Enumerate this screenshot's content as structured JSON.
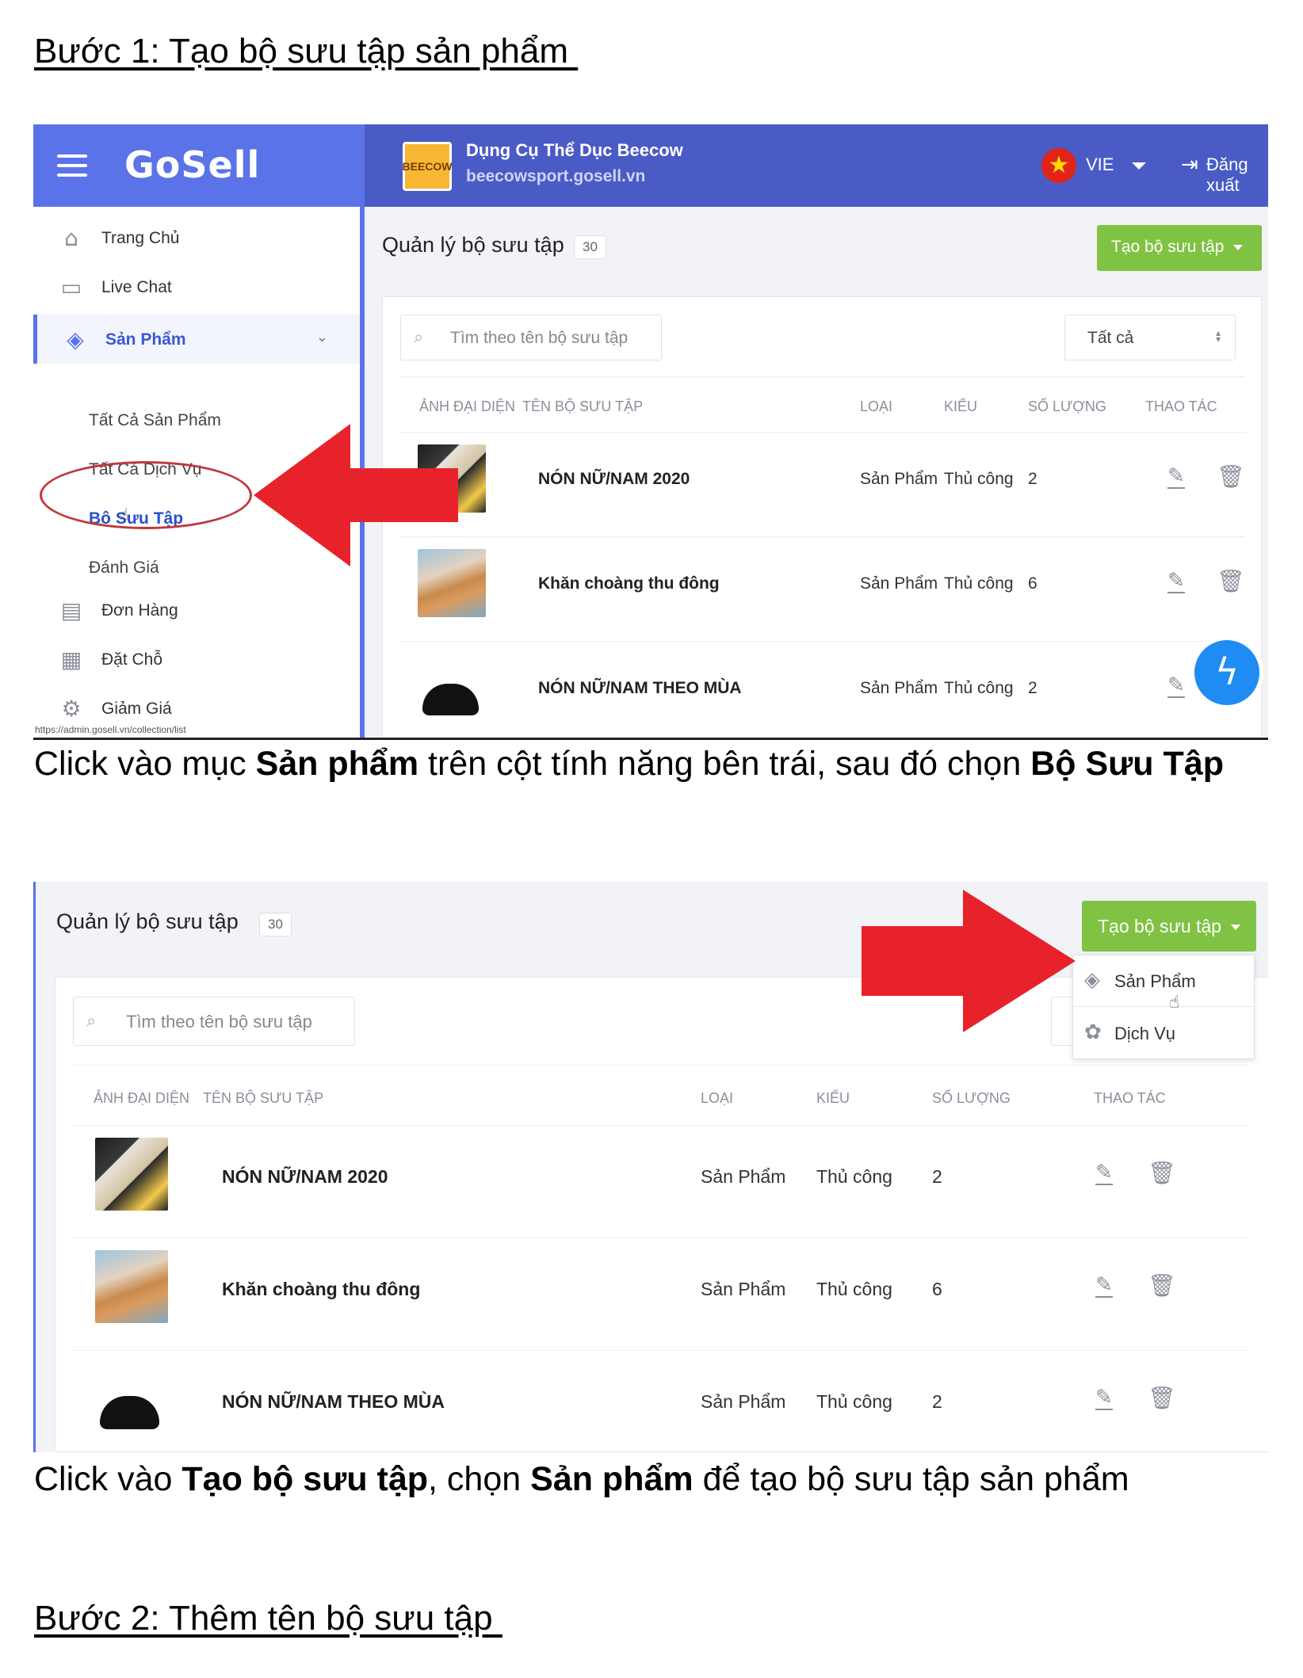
{
  "step1": {
    "heading": "Bước 1: Tạo bộ sưu tập sản phẩm "
  },
  "step2": {
    "heading": "Bước 2: Thêm tên bộ sưu tập "
  },
  "header": {
    "logo": "GoSell",
    "store_name": "Dụng Cụ Thể Dục Beecow",
    "store_url": "beecowsport.gosell.vn",
    "store_logo_text": "BEECOW",
    "language": "VIE",
    "logout": "Đăng xuất"
  },
  "sidebar": {
    "items": [
      {
        "label": "Trang Chủ",
        "icon": "home-icon"
      },
      {
        "label": "Live Chat",
        "icon": "chat-icon"
      },
      {
        "label": "Sản Phẩm",
        "icon": "tag-icon"
      },
      {
        "label": "Đơn Hàng",
        "icon": "order-icon"
      },
      {
        "label": "Đặt Chỗ",
        "icon": "calendar-icon"
      },
      {
        "label": "Giảm Giá",
        "icon": "discount-icon"
      }
    ],
    "sub_items": [
      "Tất Cả Sản Phẩm",
      "Tất Cả Dịch Vụ",
      "Bộ Sưu Tập",
      "Đánh Giá"
    ]
  },
  "status_url": "https://admin.gosell.vn/collection/list",
  "main": {
    "title": "Quản lý bộ sưu tập",
    "count": "30",
    "create_button": "Tạo bộ sưu tập",
    "search_placeholder": "Tìm theo tên bộ sưu tập",
    "filter_value": "Tất cả",
    "columns": [
      "ẢNH ĐẠI DIỆN",
      "TÊN BỘ SƯU TẬP",
      "LOẠI",
      "KIỂU",
      "SỐ LƯỢNG",
      "THAO TÁC"
    ],
    "rows": [
      {
        "name": "NÓN NỮ/NAM 2020",
        "type": "Sản Phẩm",
        "kind": "Thủ công",
        "qty": "2"
      },
      {
        "name": "Khăn choàng thu đông",
        "type": "Sản Phẩm",
        "kind": "Thủ công",
        "qty": "6"
      },
      {
        "name": "NÓN NỮ/NAM THEO MÙA",
        "type": "Sản Phẩm",
        "kind": "Thủ công",
        "qty": "2"
      }
    ]
  },
  "dropdown": {
    "items": [
      "Sản Phẩm",
      "Dịch Vụ"
    ]
  },
  "captions": {
    "c1": {
      "p1": "Click vào mục ",
      "b1": "Sản phẩm",
      "p2": " trên cột tính năng bên trái, sau đó chọn ",
      "b2": "Bộ Sưu Tập"
    },
    "c2": {
      "p1": "Click vào ",
      "b1": "Tạo bộ sưu tập",
      "p2": ", chọn ",
      "b2": "Sản phẩm",
      "p3": " để tạo bộ sưu tập sản phẩm"
    }
  },
  "colors": {
    "brand_blue": "#5b73e8",
    "header_blue": "#4a5bc6",
    "green": "#80c243",
    "arrow_red": "#e8222a"
  }
}
